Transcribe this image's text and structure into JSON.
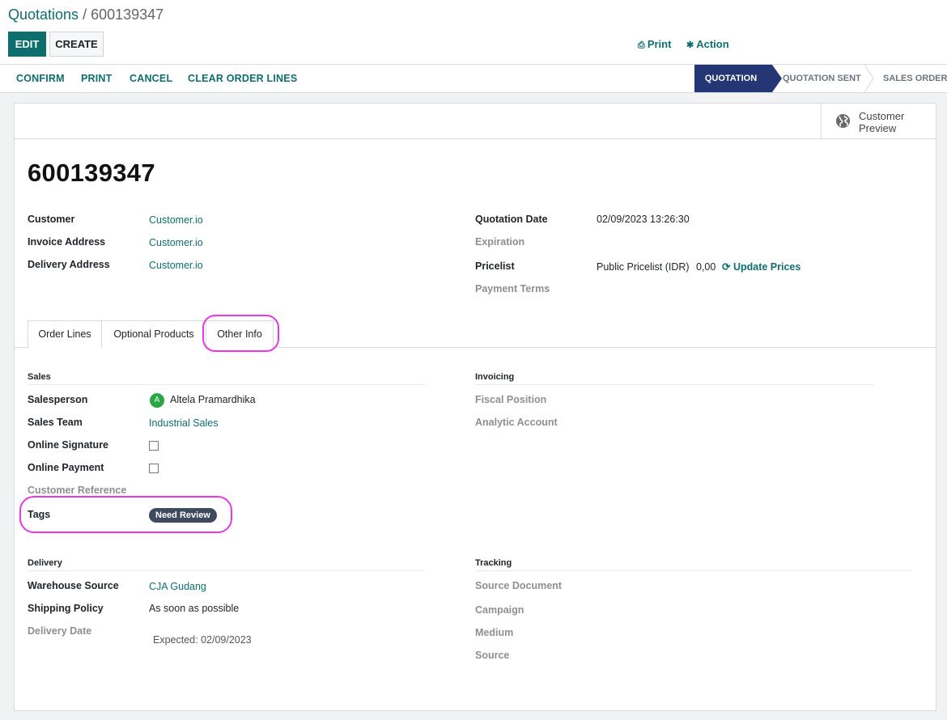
{
  "breadcrumb": {
    "parent": "Quotations",
    "separator": " / ",
    "current": "600139347"
  },
  "toolbar": {
    "edit_label": "EDIT",
    "create_label": "CREATE",
    "print_label": "Print",
    "action_label": "Action"
  },
  "statusbar": {
    "buttons": [
      "CONFIRM",
      "PRINT",
      "CANCEL",
      "CLEAR ORDER LINES"
    ],
    "stages": [
      "QUOTATION",
      "QUOTATION SENT",
      "SALES ORDER"
    ],
    "active_stage": "QUOTATION"
  },
  "smart_buttons": {
    "customer_preview": "Customer Preview"
  },
  "record": {
    "name": "600139347",
    "customer_label": "Customer",
    "customer": "Customer.io",
    "invoice_address_label": "Invoice Address",
    "invoice_address": "Customer.io",
    "delivery_address_label": "Delivery Address",
    "delivery_address": "Customer.io",
    "quotation_date_label": "Quotation Date",
    "quotation_date": "02/09/2023 13:26:30",
    "expiration_label": "Expiration",
    "pricelist_label": "Pricelist",
    "pricelist": "Public Pricelist (IDR)",
    "pricelist_amount": "0,00",
    "update_prices_label": "Update Prices",
    "payment_terms_label": "Payment Terms"
  },
  "tabs": [
    "Order Lines",
    "Optional Products",
    "Other Info"
  ],
  "active_tab": "Other Info",
  "other_info": {
    "sales": {
      "title": "Sales",
      "salesperson_label": "Salesperson",
      "salesperson_initial": "A",
      "salesperson": "Altela Pramardhika",
      "sales_team_label": "Sales Team",
      "sales_team": "Industrial Sales",
      "online_signature_label": "Online Signature",
      "online_payment_label": "Online Payment",
      "customer_reference_label": "Customer Reference",
      "tags_label": "Tags",
      "tag": "Need Review"
    },
    "invoicing": {
      "title": "Invoicing",
      "fiscal_position_label": "Fiscal Position",
      "analytic_account_label": "Analytic Account"
    },
    "delivery": {
      "title": "Delivery",
      "warehouse_label": "Warehouse Source",
      "warehouse": "CJA Gudang",
      "shipping_policy_label": "Shipping Policy",
      "shipping_policy": "As soon as possible",
      "delivery_date_label": "Delivery Date",
      "delivery_date": "Expected: 02/09/2023"
    },
    "tracking": {
      "title": "Tracking",
      "source_document_label": "Source Document",
      "campaign_label": "Campaign",
      "medium_label": "Medium",
      "source_label": "Source"
    }
  },
  "colors": {
    "primary": "#0e6e6e",
    "active_stage": "#243673",
    "tag_bg": "#3f4a5e",
    "highlight": "#e836e8",
    "avatar": "#28a745"
  },
  "icons": {
    "print": "print-icon",
    "action": "gear-icon",
    "preview": "globe-icon",
    "refresh": "refresh-icon"
  }
}
